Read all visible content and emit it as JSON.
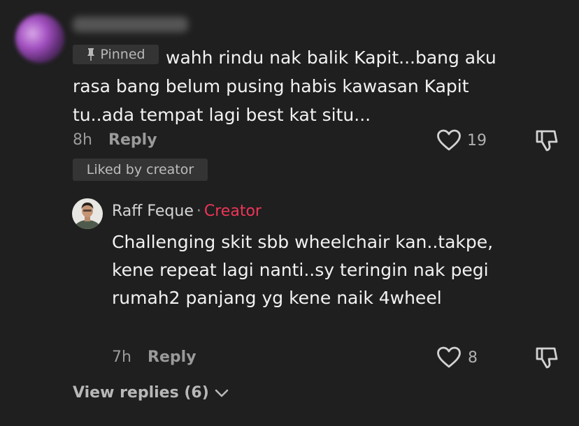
{
  "top_comment": {
    "pinned_label": "Pinned",
    "text": "wahh rindu nak balik Kapit...bang aku rasa bang belum pusing habis kawasan Kapit tu..ada tempat lagi best kat situ...",
    "time": "8h",
    "reply_label": "Reply",
    "like_count": "19",
    "liked_by": "Liked by creator"
  },
  "reply": {
    "author": "Raff Feque",
    "separator": "·",
    "creator_label": "Creator",
    "text": "Challenging skit sbb wheelchair kan..takpe, kene repeat lagi nanti..sy teringin nak pegi rumah2 panjang yg kene naik 4wheel",
    "time": "7h",
    "reply_label": "Reply",
    "like_count": "8"
  },
  "view_replies": "View replies (6)",
  "colors": {
    "background": "#1f1f1f",
    "creator_accent": "#ee3558",
    "muted_text": "#9a9a9a"
  },
  "icons": [
    "pin-icon",
    "heart-icon",
    "dislike-icon",
    "chevron-down-icon"
  ]
}
